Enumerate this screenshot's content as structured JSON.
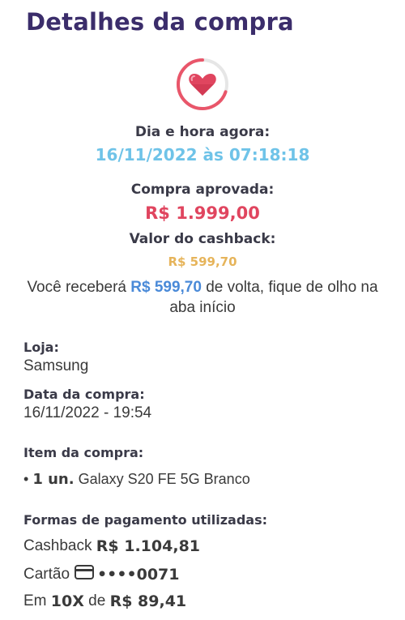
{
  "page": {
    "title": "Detalhes da compra"
  },
  "badge": {
    "icon": "heart-icon",
    "ring_progress": 0.3,
    "colors": {
      "ring": "#e9566a",
      "ring_track": "#e6e6e6",
      "heart": "#e0455f"
    }
  },
  "summary": {
    "datetime_label": "Dia e hora agora:",
    "datetime_value": "16/11/2022 às 07:18:18",
    "approved_label": "Compra aprovada:",
    "approved_amount": "R$ 1.999,00",
    "cashback_label": "Valor do cashback:",
    "cashback_amount": "R$ 599,70"
  },
  "message": {
    "prefix": "Você receberá ",
    "amount": "R$ 599,70",
    "suffix": " de volta, fique de olho na aba início"
  },
  "details": {
    "store_label": "Loja:",
    "store_value": "Samsung",
    "date_label": "Data da compra:",
    "date_value": "16/11/2022 - 19:54",
    "item_label": "Item da compra:",
    "item_bullet": "•",
    "item_qty": "1 un.",
    "item_name": "Galaxy S20 FE 5G Branco"
  },
  "payment": {
    "label": "Formas de pagamento utilizadas:",
    "cashback_label": "Cashback",
    "cashback_amount": "R$ 1.104,81",
    "card_label": "Cartão",
    "card_icon": "credit-card-icon",
    "card_number": "••••0071",
    "installment_prefix": "Em",
    "installment_count": "10X",
    "installment_of": "de",
    "installment_amount": "R$ 89,41"
  },
  "colors": {
    "title": "#3b2d6b",
    "datetime": "#6fc3e8",
    "price": "#e0455f",
    "cashback": "#e6b45a",
    "highlight": "#4a8ad8"
  }
}
